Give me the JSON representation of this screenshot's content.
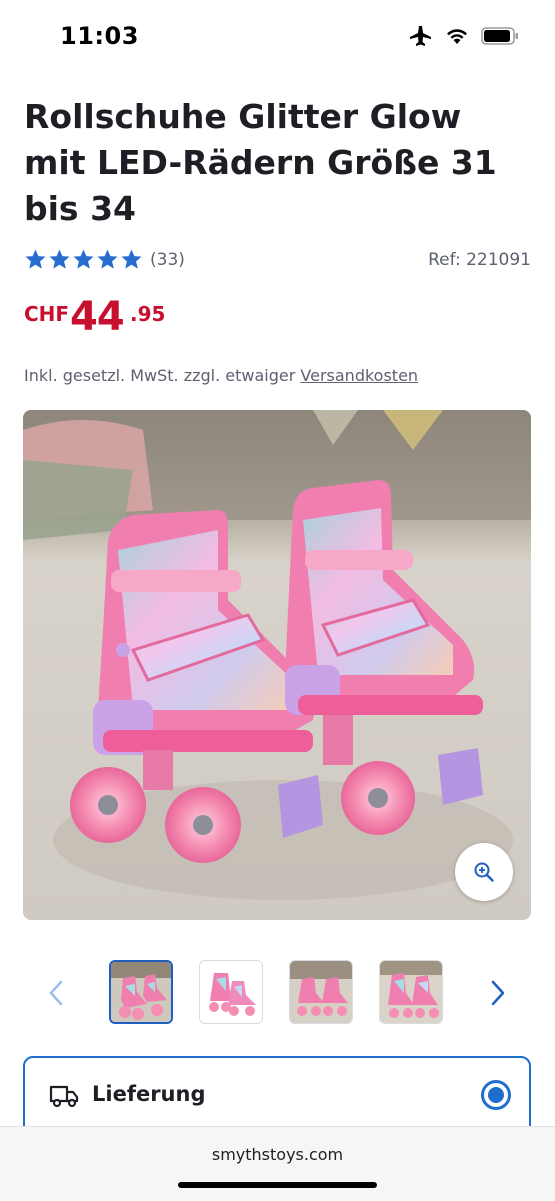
{
  "status_bar": {
    "time": "11:03",
    "icons": [
      "airplane-icon",
      "wifi-icon",
      "battery-icon"
    ]
  },
  "product": {
    "title": "Rollschuhe Glitter Glow mit LED-Rädern Größe 31 bis 34",
    "rating": 5,
    "review_count": "(33)",
    "ref": "Ref: 221091",
    "price": {
      "currency": "CHF",
      "main": "44",
      "cents": ".95"
    },
    "tax_note": "Inkl. gesetzl. MwSt. zzgl. etwaiger",
    "tax_link": "Versandkosten"
  },
  "gallery": {
    "zoom_icon": "zoom-in-icon",
    "prev_icon": "chevron-left-icon",
    "next_icon": "chevron-right-icon",
    "selected_index": 0,
    "thumbnail_count": 4
  },
  "delivery": {
    "label": "Lieferung",
    "icon": "truck-icon",
    "selected": true
  },
  "browser": {
    "url": "smythstoys.com"
  },
  "colors": {
    "price": "#c8102e",
    "accent": "#1f6ecf",
    "star": "#2a6dd0",
    "text": "#1e1f24",
    "muted": "#5e6170"
  }
}
